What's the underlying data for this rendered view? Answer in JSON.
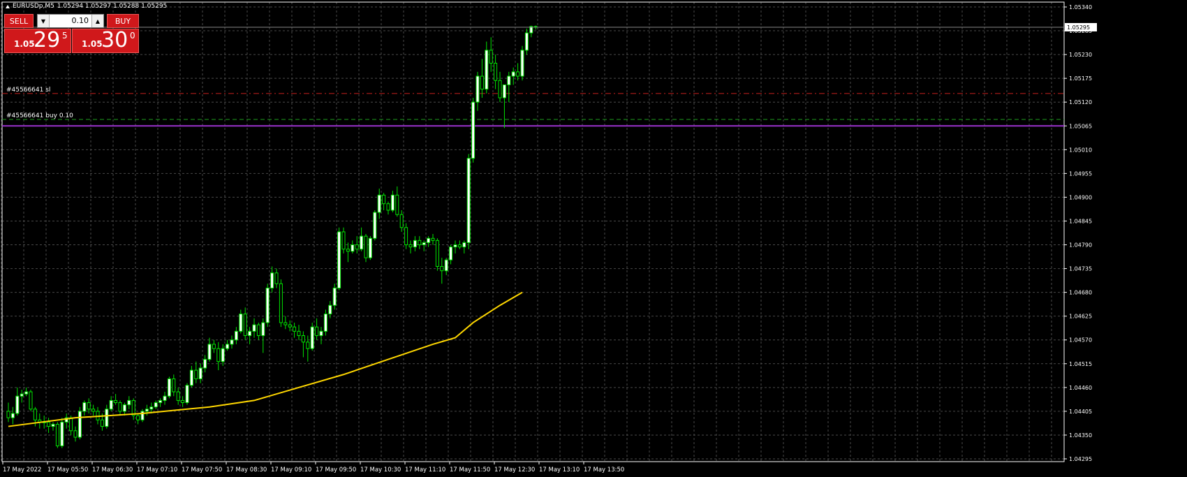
{
  "header": {
    "symbol": "EURUSDp,M5",
    "ohlc": "1.05294 1.05297 1.05288 1.05295"
  },
  "trade_panel": {
    "sell_label": "SELL",
    "buy_label": "BUY",
    "lot": "0.10",
    "sell_price": {
      "prefix": "1.05",
      "big": "29",
      "sup": "5"
    },
    "buy_price": {
      "prefix": "1.05",
      "big": "30",
      "sup": "0"
    }
  },
  "orders": {
    "sl_label": "#45566641 sl",
    "buy_label": "#45566641 buy 0.10",
    "sl_price": 1.0514,
    "open_price": 1.0508,
    "level_price": 1.05065
  },
  "colors": {
    "background": "#000000",
    "grid": "#4a4a4a",
    "bull_body": "#ffffff",
    "bear_body": "#000000",
    "candle_outline": "#00e600",
    "ma": "#ffd700",
    "sl_line": "#c8201e",
    "open_line": "#1e9e1e",
    "level_line": "#9932cc",
    "axis_text": "#ffffff"
  },
  "chart_data": {
    "type": "candlestick",
    "timeframe": "M5",
    "current_price": "1.05295",
    "y_ticks": [
      "1.05340",
      "1.05285",
      "1.05230",
      "1.05175",
      "1.05120",
      "1.05065",
      "1.05010",
      "1.04955",
      "1.04900",
      "1.04845",
      "1.04790",
      "1.04735",
      "1.04680",
      "1.04625",
      "1.04570",
      "1.04515",
      "1.04460",
      "1.04405",
      "1.04350",
      "1.04295"
    ],
    "ylim": [
      1.04295,
      1.0534
    ],
    "x_labels": [
      "17 May 2022",
      "17 May 05:50",
      "17 May 06:30",
      "17 May 07:10",
      "17 May 07:50",
      "17 May 08:30",
      "17 May 09:10",
      "17 May 09:50",
      "17 May 10:30",
      "17 May 11:10",
      "17 May 11:50",
      "17 May 12:30",
      "17 May 13:10",
      "17 May 13:50"
    ],
    "candles": [
      [
        1.04405,
        1.04425,
        1.0438,
        1.0439
      ],
      [
        1.0439,
        1.04415,
        1.04375,
        1.044
      ],
      [
        1.044,
        1.0446,
        1.04395,
        1.0444
      ],
      [
        1.0444,
        1.04455,
        1.04425,
        1.04445
      ],
      [
        1.04445,
        1.0446,
        1.0444,
        1.0445
      ],
      [
        1.0445,
        1.04455,
        1.04405,
        1.0441
      ],
      [
        1.0441,
        1.04415,
        1.0437,
        1.04385
      ],
      [
        1.04385,
        1.044,
        1.04365,
        1.0438
      ],
      [
        1.0438,
        1.04395,
        1.04365,
        1.0438
      ],
      [
        1.0438,
        1.0439,
        1.04355,
        1.0437
      ],
      [
        1.0437,
        1.0438,
        1.0436,
        1.04375
      ],
      [
        1.04375,
        1.0438,
        1.0432,
        1.04325
      ],
      [
        1.04325,
        1.0439,
        1.0432,
        1.0438
      ],
      [
        1.0438,
        1.044,
        1.04365,
        1.0439
      ],
      [
        1.0439,
        1.04395,
        1.0435,
        1.0436
      ],
      [
        1.0436,
        1.0437,
        1.04335,
        1.04345
      ],
      [
        1.04345,
        1.04415,
        1.0434,
        1.04405
      ],
      [
        1.04405,
        1.0443,
        1.04395,
        1.04425
      ],
      [
        1.04425,
        1.04435,
        1.044,
        1.0441
      ],
      [
        1.0441,
        1.0442,
        1.04395,
        1.04405
      ],
      [
        1.04405,
        1.04415,
        1.04375,
        1.04385
      ],
      [
        1.04385,
        1.044,
        1.0436,
        1.0437
      ],
      [
        1.0437,
        1.0442,
        1.04365,
        1.0441
      ],
      [
        1.0441,
        1.0444,
        1.04405,
        1.0443
      ],
      [
        1.0443,
        1.04445,
        1.0442,
        1.04425
      ],
      [
        1.04425,
        1.0443,
        1.04395,
        1.04405
      ],
      [
        1.04405,
        1.04425,
        1.04395,
        1.0442
      ],
      [
        1.0442,
        1.0444,
        1.0441,
        1.0443
      ],
      [
        1.0443,
        1.04435,
        1.04385,
        1.04395
      ],
      [
        1.04395,
        1.044,
        1.04375,
        1.04385
      ],
      [
        1.04385,
        1.0441,
        1.0438,
        1.04405
      ],
      [
        1.04405,
        1.0442,
        1.04395,
        1.0441
      ],
      [
        1.0441,
        1.04425,
        1.044,
        1.04415
      ],
      [
        1.04415,
        1.0443,
        1.0441,
        1.04425
      ],
      [
        1.04425,
        1.04435,
        1.04415,
        1.0443
      ],
      [
        1.0443,
        1.0445,
        1.0442,
        1.0444
      ],
      [
        1.0444,
        1.04485,
        1.04435,
        1.0448
      ],
      [
        1.0448,
        1.0449,
        1.0444,
        1.0445
      ],
      [
        1.0445,
        1.0446,
        1.0442,
        1.0443
      ],
      [
        1.0443,
        1.0444,
        1.04415,
        1.04425
      ],
      [
        1.04425,
        1.0447,
        1.0442,
        1.04465
      ],
      [
        1.04465,
        1.0451,
        1.0446,
        1.045
      ],
      [
        1.045,
        1.0452,
        1.0447,
        1.0448
      ],
      [
        1.0448,
        1.04515,
        1.0447,
        1.04505
      ],
      [
        1.04505,
        1.04535,
        1.04495,
        1.04525
      ],
      [
        1.04525,
        1.04575,
        1.0452,
        1.0456
      ],
      [
        1.0456,
        1.0457,
        1.0454,
        1.0455
      ],
      [
        1.0455,
        1.04565,
        1.045,
        1.0452
      ],
      [
        1.0452,
        1.0456,
        1.0451,
        1.0455
      ],
      [
        1.0455,
        1.0457,
        1.04545,
        1.0456
      ],
      [
        1.0456,
        1.0458,
        1.0455,
        1.0457
      ],
      [
        1.0457,
        1.046,
        1.0456,
        1.0459
      ],
      [
        1.0459,
        1.0464,
        1.04585,
        1.0463
      ],
      [
        1.0463,
        1.04645,
        1.0457,
        1.0458
      ],
      [
        1.0458,
        1.046,
        1.0456,
        1.0459
      ],
      [
        1.0459,
        1.0462,
        1.04575,
        1.04605
      ],
      [
        1.04605,
        1.0461,
        1.0457,
        1.0458
      ],
      [
        1.0458,
        1.0462,
        1.0454,
        1.0461
      ],
      [
        1.0461,
        1.047,
        1.046,
        1.0469
      ],
      [
        1.0469,
        1.0474,
        1.0468,
        1.04725
      ],
      [
        1.04725,
        1.04735,
        1.0469,
        1.047
      ],
      [
        1.047,
        1.0471,
        1.046,
        1.0461
      ],
      [
        1.0461,
        1.04625,
        1.04595,
        1.04605
      ],
      [
        1.04605,
        1.04615,
        1.0459,
        1.046
      ],
      [
        1.046,
        1.0461,
        1.04575,
        1.0459
      ],
      [
        1.0459,
        1.04605,
        1.0457,
        1.0458
      ],
      [
        1.0458,
        1.0459,
        1.0453,
        1.04565
      ],
      [
        1.04565,
        1.0458,
        1.0452,
        1.0455
      ],
      [
        1.0455,
        1.0461,
        1.04545,
        1.046
      ],
      [
        1.046,
        1.0462,
        1.0457,
        1.0458
      ],
      [
        1.0458,
        1.046,
        1.0456,
        1.0459
      ],
      [
        1.0459,
        1.0464,
        1.0458,
        1.0463
      ],
      [
        1.0463,
        1.0466,
        1.0462,
        1.0465
      ],
      [
        1.0465,
        1.047,
        1.0464,
        1.0469
      ],
      [
        1.0469,
        1.0483,
        1.04685,
        1.0482
      ],
      [
        1.0482,
        1.0483,
        1.0477,
        1.0478
      ],
      [
        1.0478,
        1.04795,
        1.0475,
        1.04775
      ],
      [
        1.04775,
        1.048,
        1.0477,
        1.0479
      ],
      [
        1.0479,
        1.0481,
        1.0477,
        1.0478
      ],
      [
        1.0478,
        1.0483,
        1.04775,
        1.0481
      ],
      [
        1.0481,
        1.04815,
        1.0475,
        1.0476
      ],
      [
        1.0476,
        1.0481,
        1.04755,
        1.04805
      ],
      [
        1.04805,
        1.0487,
        1.048,
        1.04865
      ],
      [
        1.04865,
        1.0492,
        1.0485,
        1.04905
      ],
      [
        1.04905,
        1.0491,
        1.0487,
        1.04885
      ],
      [
        1.04885,
        1.0489,
        1.0486,
        1.0487
      ],
      [
        1.0487,
        1.04915,
        1.04865,
        1.04905
      ],
      [
        1.04905,
        1.04925,
        1.04855,
        1.0486
      ],
      [
        1.0486,
        1.0487,
        1.0482,
        1.0483
      ],
      [
        1.0483,
        1.0484,
        1.0478,
        1.0479
      ],
      [
        1.0479,
        1.048,
        1.0477,
        1.04785
      ],
      [
        1.04785,
        1.0481,
        1.04775,
        1.048
      ],
      [
        1.048,
        1.0481,
        1.0478,
        1.0479
      ],
      [
        1.0479,
        1.048,
        1.04775,
        1.04795
      ],
      [
        1.04795,
        1.0481,
        1.04785,
        1.04805
      ],
      [
        1.04805,
        1.04815,
        1.0479,
        1.048
      ],
      [
        1.048,
        1.04805,
        1.0473,
        1.0474
      ],
      [
        1.0474,
        1.0476,
        1.047,
        1.0473
      ],
      [
        1.0473,
        1.0476,
        1.0472,
        1.04755
      ],
      [
        1.04755,
        1.0479,
        1.04745,
        1.04785
      ],
      [
        1.04785,
        1.048,
        1.0477,
        1.0479
      ],
      [
        1.0479,
        1.048,
        1.0478,
        1.04785
      ],
      [
        1.04785,
        1.048,
        1.0477,
        1.04795
      ],
      [
        1.04795,
        1.05,
        1.0478,
        1.0499
      ],
      [
        1.0499,
        1.0513,
        1.0498,
        1.0512
      ],
      [
        1.0512,
        1.0519,
        1.051,
        1.0518
      ],
      [
        1.0518,
        1.0522,
        1.0513,
        1.0515
      ],
      [
        1.0515,
        1.0526,
        1.0514,
        1.0524
      ],
      [
        1.0524,
        1.0527,
        1.0519,
        1.0521
      ],
      [
        1.0521,
        1.0523,
        1.0515,
        1.0517
      ],
      [
        1.0517,
        1.0519,
        1.0512,
        1.0513
      ],
      [
        1.0513,
        1.0515,
        1.0506,
        1.0516
      ],
      [
        1.0516,
        1.0519,
        1.0512,
        1.0518
      ],
      [
        1.0518,
        1.052,
        1.0516,
        1.0519
      ],
      [
        1.0519,
        1.0521,
        1.0517,
        1.0518
      ],
      [
        1.0518,
        1.0525,
        1.0517,
        1.0524
      ],
      [
        1.0524,
        1.0529,
        1.0523,
        1.0528
      ],
      [
        1.0528,
        1.05297,
        1.0527,
        1.05295
      ],
      [
        1.05294,
        1.05297,
        1.05288,
        1.05295
      ]
    ],
    "ma": {
      "color": "#ffd700",
      "points": [
        [
          0,
          1.0437
        ],
        [
          15,
          1.0439
        ],
        [
          30,
          1.044
        ],
        [
          45,
          1.04415
        ],
        [
          55,
          1.0443
        ],
        [
          65,
          1.0446
        ],
        [
          75,
          1.0449
        ],
        [
          85,
          1.04525
        ],
        [
          95,
          1.0456
        ],
        [
          100,
          1.04575
        ],
        [
          104,
          1.0461
        ],
        [
          110,
          1.0465
        ],
        [
          115,
          1.0468
        ]
      ]
    }
  }
}
